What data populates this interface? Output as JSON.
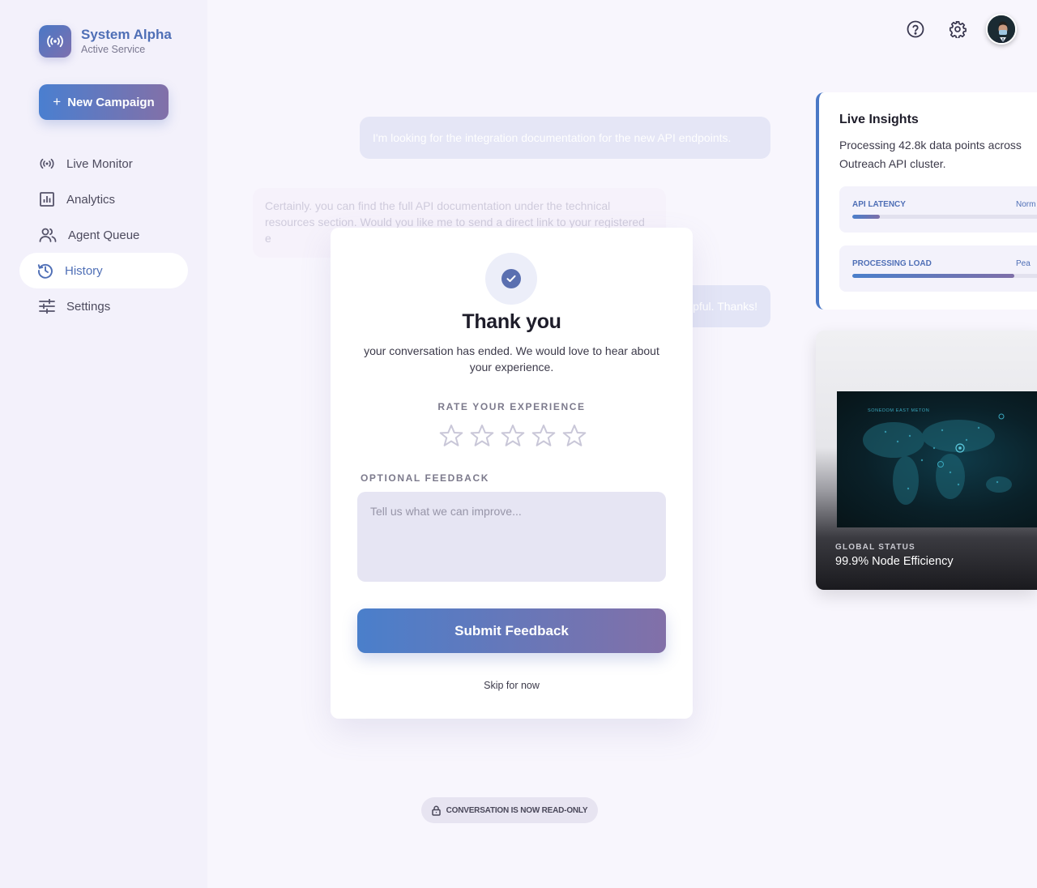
{
  "brand": {
    "title": "System Alpha",
    "subtitle": "Active Service"
  },
  "sidebar": {
    "new_campaign_label": "New Campaign",
    "items": [
      {
        "label": "Live Monitor",
        "icon": "broadcast-icon"
      },
      {
        "label": "Analytics",
        "icon": "bar-chart-icon"
      },
      {
        "label": "Agent Queue",
        "icon": "users-icon"
      },
      {
        "label": "History",
        "icon": "history-icon",
        "active": true
      },
      {
        "label": "Settings",
        "icon": "sliders-icon"
      }
    ]
  },
  "header": {
    "icons": [
      "help-icon",
      "gear-icon",
      "avatar"
    ]
  },
  "chat": {
    "user_message": "I'm looking for the integration documentation for the new API endpoints.",
    "agent_message": "Certainly. you can find the full API documentation under the technical resources section. Would you like me to send a direct link to your registered e",
    "user_message_2": "pful. Thanks!"
  },
  "modal": {
    "title": "Thank you",
    "description": "your conversation has ended. We would love to hear about your experience.",
    "rate_label": "RATE YOUR EXPERIENCE",
    "rating": 0,
    "rating_max": 5,
    "feedback_label": "OPTIONAL FEEDBACK",
    "feedback_placeholder": "Tell us what we can improve...",
    "feedback_value": "",
    "submit_label": "Submit Feedback",
    "skip_label": "Skip for now"
  },
  "readonly_notice": "CONVERSATION IS NOW READ-ONLY",
  "insights": {
    "title": "Live Insights",
    "description_line1": "Processing 42.8k data points across",
    "description_line2": "Outreach API cluster.",
    "metrics": [
      {
        "label": "API LATENCY",
        "status": "Norm",
        "fill": 0.14
      },
      {
        "label": "PROCESSING LOAD",
        "status": "Pea",
        "fill": 0.82
      }
    ]
  },
  "global_status": {
    "label": "GLOBAL STATUS",
    "value": "99.9% Node Efficiency",
    "map_caption": "SONEDOM EAST METON"
  },
  "colors": {
    "accent": "#4f6fb6",
    "gradient_start": "#4a7fcb",
    "gradient_end": "#8270a8",
    "background": "#f8f6fd",
    "sidebar_bg": "#f3f1fb"
  }
}
